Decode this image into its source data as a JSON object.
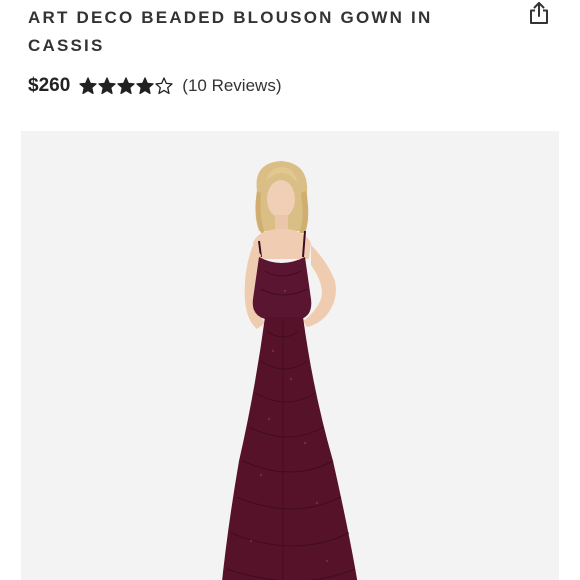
{
  "product": {
    "title": "ART DECO BEADED BLOUSON GOWN IN CASSIS",
    "price": "$260",
    "rating": 4,
    "rating_max": 5,
    "reviews_label": "(10 Reviews)"
  },
  "icons": {
    "share": "share-icon",
    "star_filled": "star-filled-icon",
    "star_empty": "star-outline-icon"
  },
  "colors": {
    "gown": "#5a1530",
    "image_background": "#f4f3f3",
    "text": "#333333"
  }
}
